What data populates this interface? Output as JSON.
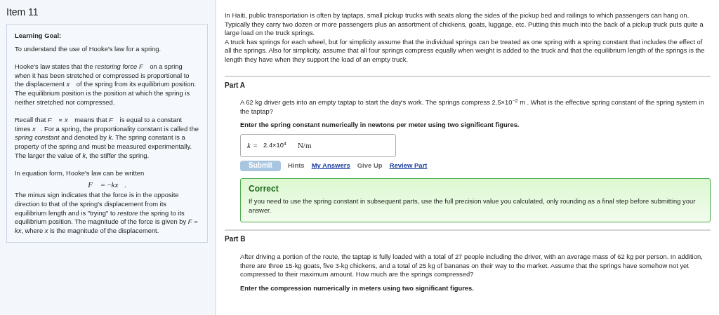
{
  "item_title": "Item 11",
  "learning_goal": {
    "heading": "Learning Goal:",
    "paragraphs": [
      "To understand the use of Hooke's law for a spring.",
      "Hooke's law states that the *restoring force* *F⃗* on a spring when it has been stretched or compressed is proportional to the displacement *x⃗* of the spring from its equilibrium position. The equilibrium position is the position at which the spring is neither stretched nor compressed.",
      "Recall that *F⃗* ∝ *x⃗* means that *F⃗* is equal to a constant times *x⃗*. For a spring, the proportionality constant is called the *spring constant* and denoted by *k*. The spring constant is a property of the spring and must be measured experimentally. The larger the value of *k*, the stiffer the spring.",
      "In equation form, Hooke's law can be written"
    ],
    "equation": "*F⃗* = −*kx⃗*.",
    "closing": "The minus sign indicates that the force is in the opposite direction to that of the spring's displacement from its equilibrium length and is \"trying\" to *restore* the spring to its equilibrium position. The magnitude of the force is given by *F* = *kx*, where *x* is the magnitude of the displacement."
  },
  "intro": [
    "In Haiti, public transportation is often by taptaps, small pickup trucks with seats along the sides of the pickup bed and railings to which passengers can hang on. Typically they carry two dozen or more passengers plus an assortment of chickens, goats, luggage, etc. Putting this much into the back of a pickup truck puts quite a large load on the truck springs.",
    "A truck has springs for each wheel, but for simplicity assume that the individual springs can be treated as one spring with a spring constant that includes the effect of all the springs. Also for simplicity, assume that all four springs compress equally when weight is added to the truck and that the equilibrium length of the springs is the length they have when they support the load of an empty truck."
  ],
  "parts": [
    {
      "title": "Part A",
      "question": "A 62 kg driver gets into an empty taptap to start the day's work. The springs compress 2.5×10$^{−2}$ m . What is the effective spring constant of the spring system in the taptap?",
      "instruction": "Enter the spring constant numerically in newtons per meter using two significant figures.",
      "answer": {
        "variable": "k =",
        "value": "2.4×10$^{4}$",
        "unit": "N/m"
      },
      "actions": [
        {
          "label": "Submit",
          "kind": "button",
          "disabled": true
        },
        {
          "label": "Hints",
          "kind": "plain"
        },
        {
          "label": "My Answers",
          "kind": "link"
        },
        {
          "label": "Give Up",
          "kind": "plain"
        },
        {
          "label": "Review Part",
          "kind": "link"
        }
      ],
      "feedback": {
        "kind": "correct",
        "title": "Correct",
        "message": "If you need to use the spring constant in subsequent parts, use the full precision value you calculated, only rounding as a final step before submitting your answer."
      }
    },
    {
      "title": "Part B",
      "question": "After driving a portion of the route, the taptap is fully loaded with a total of 27 people including the driver, with an average mass of 62 kg per person. In addition, there are three 15-kg goats, five 3-kg chickens, and a total of 25 kg of bananas on their way to the market. Assume that the springs have somehow not yet compressed to their maximum amount. How much are the springs compressed?",
      "instruction": "Enter the compression numerically in meters using two significant figures."
    }
  ]
}
